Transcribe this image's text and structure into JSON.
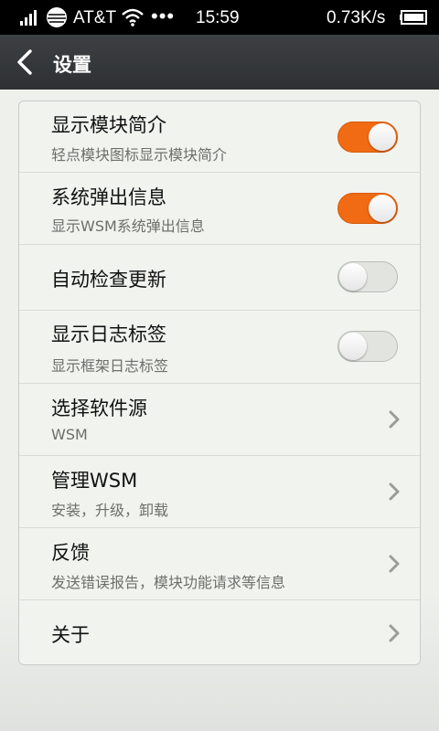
{
  "status_bar": {
    "carrier": "AT&T",
    "dots": "•••",
    "time": "15:59",
    "speed": "0.73K/s"
  },
  "header": {
    "title": "设置"
  },
  "settings": {
    "items": [
      {
        "title": "显示模块简介",
        "subtitle": "轻点模块图标显示模块简介",
        "toggle": true
      },
      {
        "title": "系统弹出信息",
        "subtitle": "显示WSM系统弹出信息",
        "toggle": true
      },
      {
        "title": "自动检查更新",
        "subtitle": "",
        "toggle": false
      },
      {
        "title": "显示日志标签",
        "subtitle": "显示框架日志标签",
        "toggle": false
      },
      {
        "title": "选择软件源",
        "subtitle": "WSM"
      },
      {
        "title": "管理WSM",
        "subtitle": "安装，升级，卸载"
      },
      {
        "title": "反馈",
        "subtitle": "发送错误报告，模块功能请求等信息"
      },
      {
        "title": "关于",
        "subtitle": ""
      }
    ]
  },
  "colors": {
    "accent": "#f06b14",
    "header_bg": "#35383a",
    "card_bg": "#f1f3ef"
  }
}
